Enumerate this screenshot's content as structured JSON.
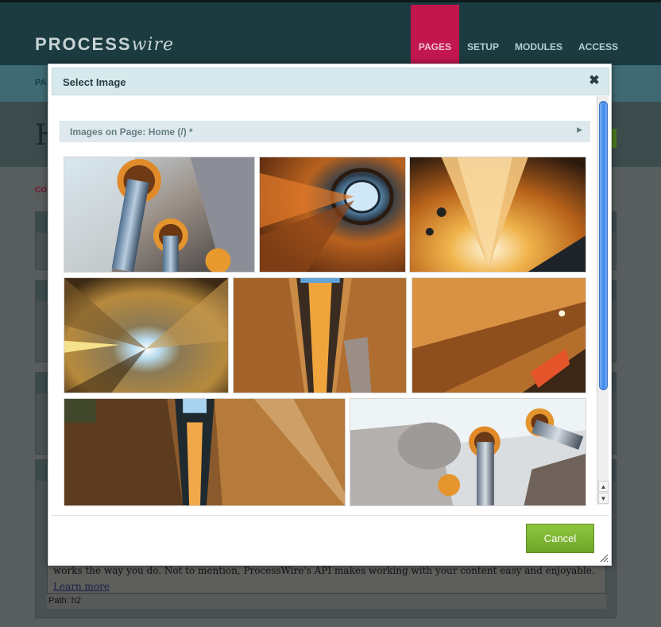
{
  "app": {
    "logo_main": "PROCESS",
    "logo_script": "wire",
    "nav": [
      "PAGES",
      "SETUP",
      "MODULES",
      "ACCESS"
    ],
    "subnav_label": "PA",
    "page_title_letter": "H",
    "crumb": "CO",
    "editor_text": "works the way you do. Not to mention, ProcessWire's API makes working with your content easy and enjoyable.",
    "editor_link": "Learn more",
    "editor_path": "Path: h2"
  },
  "dialog": {
    "title": "Select Image",
    "close_glyph": "✖",
    "section_title": "Images on Page: Home (/) *",
    "section_caret": "▶",
    "cancel_label": "Cancel",
    "images": [
      {
        "variant": "columns-skylight"
      },
      {
        "variant": "spiral-oculus"
      },
      {
        "variant": "gold-chandelier"
      },
      {
        "variant": "atrium-up-view"
      },
      {
        "variant": "elevator-shaft"
      },
      {
        "variant": "angled-atrium"
      },
      {
        "variant": "elevator-column-wide"
      },
      {
        "variant": "columns-glass-roof"
      }
    ]
  },
  "colors": {
    "accent_nav": "#c2164e",
    "dialog_header": "#d7e9ec",
    "cancel_button": "#7db234",
    "scroll_thumb": "#3d8aee"
  }
}
